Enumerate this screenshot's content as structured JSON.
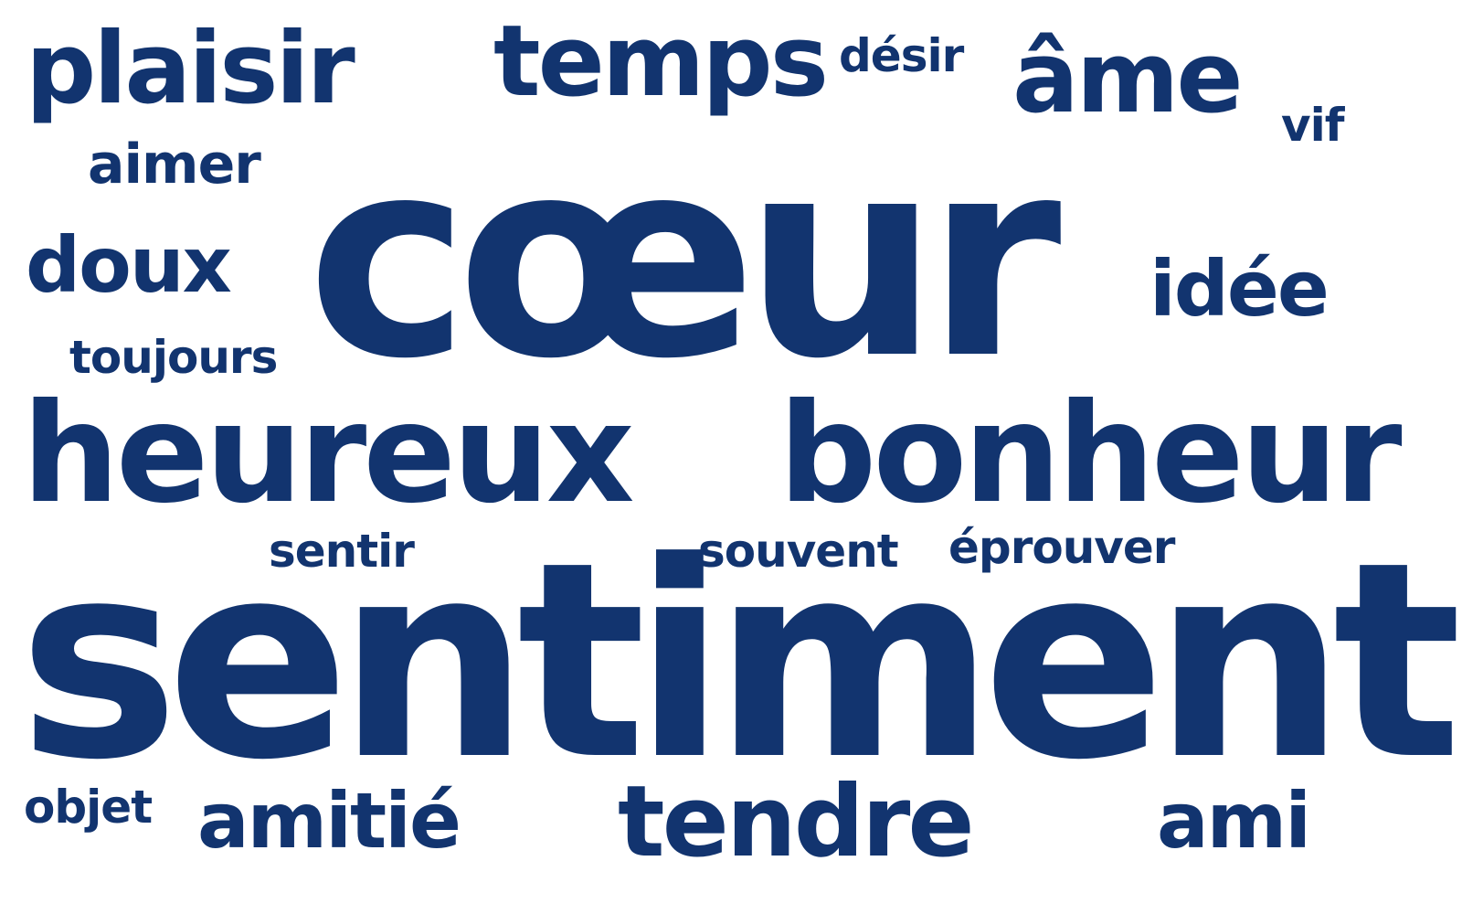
{
  "cloud": {
    "text_color": "#12346f",
    "background_color": "#ffffff",
    "words": {
      "coeur": "cœur",
      "sentiment": "sentiment",
      "heureux": "heureux",
      "bonheur": "bonheur",
      "plaisir": "plaisir",
      "temps": "temps",
      "ame": "âme",
      "doux": "doux",
      "idee": "idée",
      "tendre": "tendre",
      "amitie": "amitié",
      "ami": "ami",
      "aimer": "aimer",
      "toujours": "toujours",
      "desir": "désir",
      "vif": "vif",
      "sentir": "sentir",
      "souvent": "souvent",
      "eprouver": "éprouver",
      "objet": "objet"
    }
  }
}
